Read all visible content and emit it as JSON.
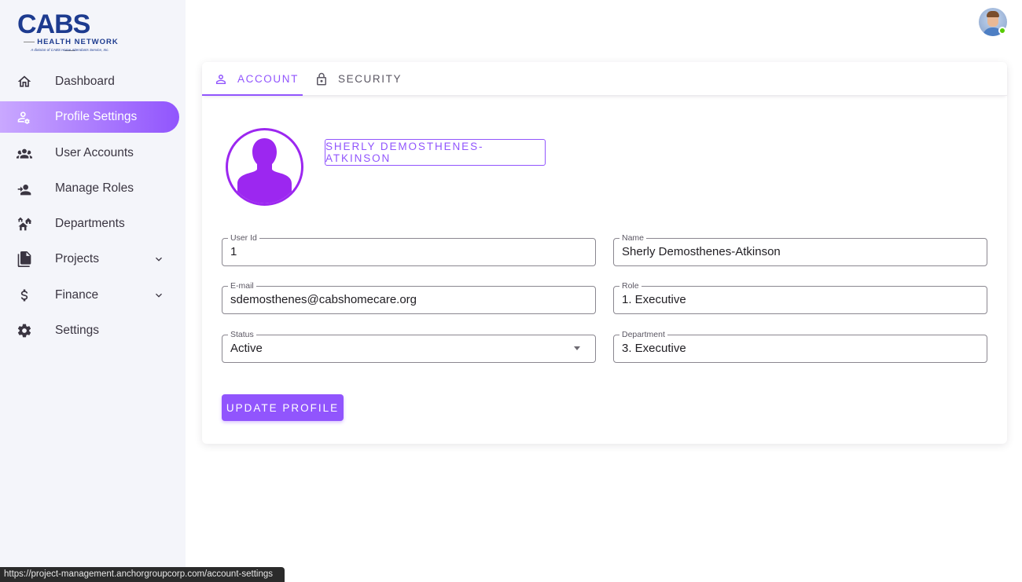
{
  "brand": {
    "name": "CABS",
    "subtitle": "HEALTH NETWORK",
    "tagline": "A division of CABS Home Attendants Service, Inc."
  },
  "sidebar": {
    "items": [
      {
        "label": "Dashboard",
        "icon": "home-icon",
        "active": false
      },
      {
        "label": "Profile Settings",
        "icon": "account-cog-icon",
        "active": true
      },
      {
        "label": "User Accounts",
        "icon": "account-group-icon",
        "active": false
      },
      {
        "label": "Manage Roles",
        "icon": "account-arrow-icon",
        "active": false
      },
      {
        "label": "Departments",
        "icon": "home-group-icon",
        "active": false
      },
      {
        "label": "Projects",
        "icon": "file-multiple-icon",
        "active": false,
        "expandable": true
      },
      {
        "label": "Finance",
        "icon": "currency-usd-icon",
        "active": false,
        "expandable": true
      },
      {
        "label": "Settings",
        "icon": "cog-icon",
        "active": false
      }
    ]
  },
  "tabs": {
    "account": "ACCOUNT",
    "security": "SECURITY",
    "active": "account"
  },
  "profile": {
    "name_button": "SHERLY DEMOSTHENES-ATKINSON",
    "fields": {
      "user_id": {
        "label": "User Id",
        "value": "1"
      },
      "name": {
        "label": "Name",
        "value": "Sherly Demosthenes-Atkinson"
      },
      "email": {
        "label": "E-mail",
        "value": "sdemosthenes@cabshomecare.org"
      },
      "role": {
        "label": "Role",
        "value": "1. Executive"
      },
      "status": {
        "label": "Status",
        "value": "Active"
      },
      "department": {
        "label": "Department",
        "value": "3. Executive"
      }
    },
    "update_button": "UPDATE PROFILE"
  },
  "browser_status": {
    "url": "https://project-management.anchorgroupcorp.com/account-settings"
  },
  "colors": {
    "primary": "#9155fd",
    "avatar_ring": "#9c27f0",
    "sidebar_bg": "#f4f5fa",
    "online": "#56ca00"
  }
}
